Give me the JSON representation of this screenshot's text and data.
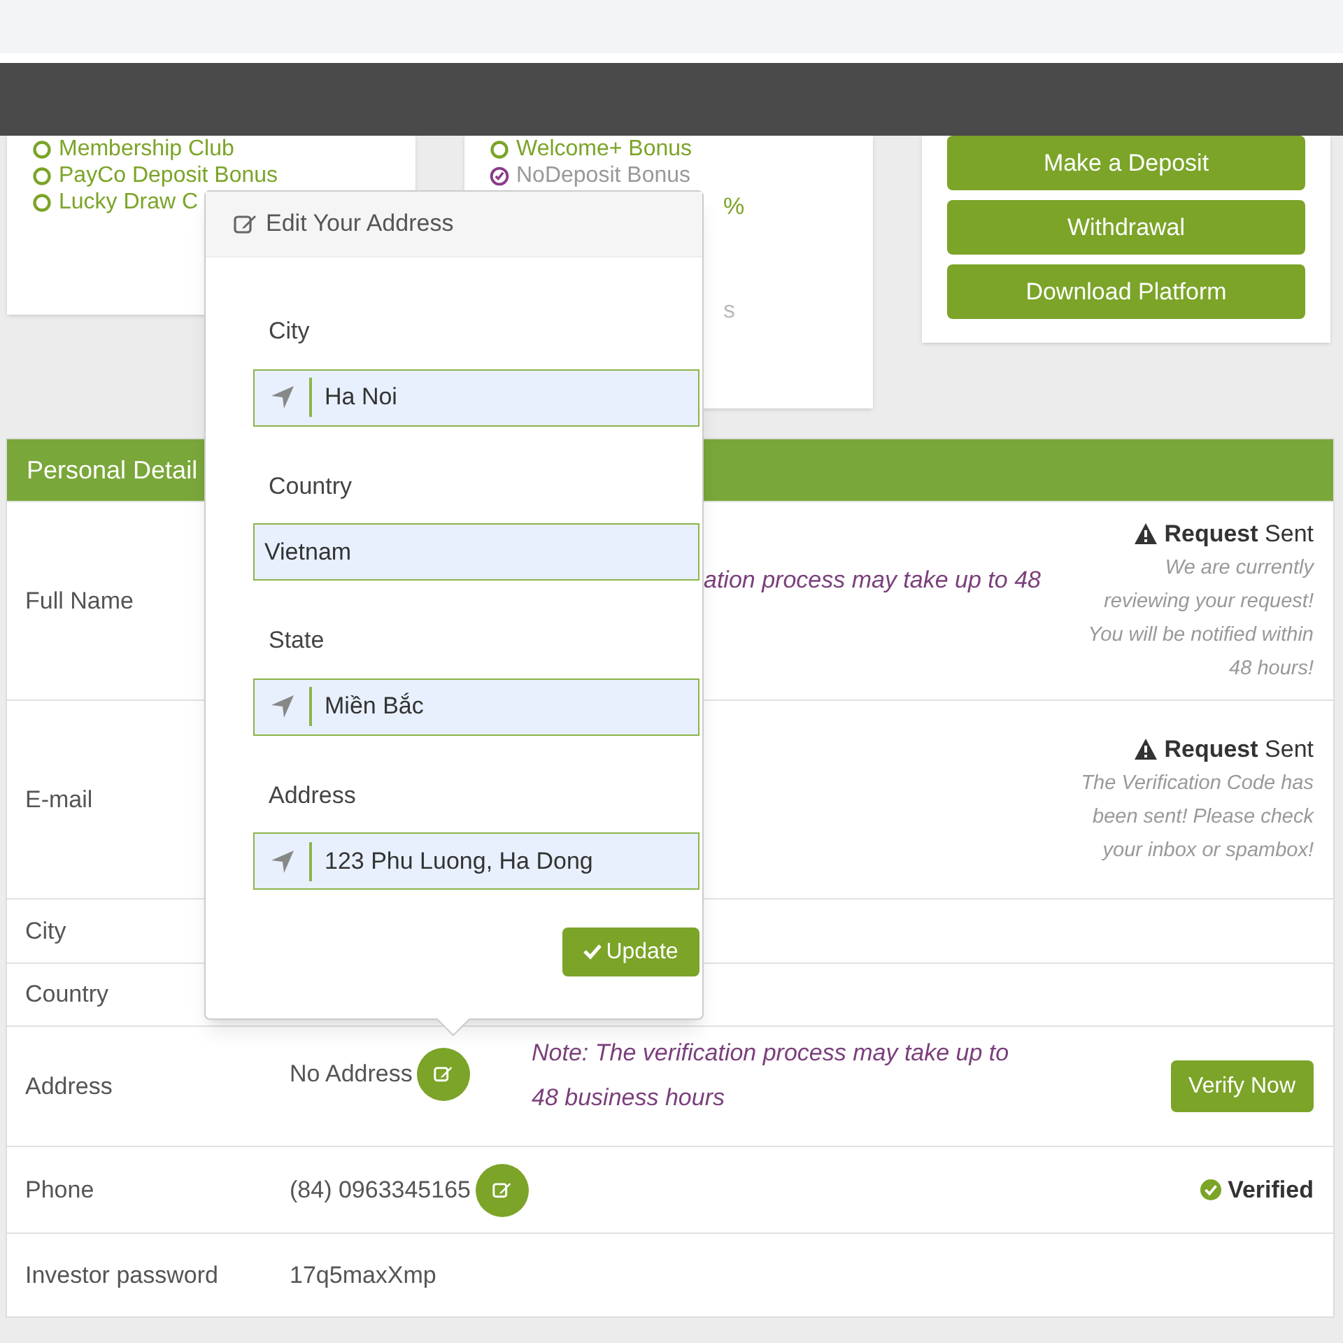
{
  "bonus_cards": [
    {
      "items": [
        {
          "label": "Membership Club",
          "kind": "open"
        },
        {
          "label": "PayCo Deposit Bonus",
          "kind": "open"
        },
        {
          "label": "Lucky Draw C",
          "kind": "open"
        }
      ]
    },
    {
      "items": [
        {
          "label": "Welcome+ Bonus",
          "kind": "open"
        },
        {
          "label": "NoDeposit Bonus",
          "kind": "done"
        }
      ],
      "fragments": [
        "%",
        "s"
      ]
    }
  ],
  "actions": [
    "Make a Deposit",
    "Withdrawal",
    "Download Platform"
  ],
  "personal_details": {
    "title": "Personal Detail",
    "rows": [
      {
        "label": "Full Name",
        "note": "ation process may take up to 48",
        "status": {
          "kind": "request",
          "bold": "Request",
          "rest": "Sent",
          "message": "We are currently reviewing your request! You will be notified within 48 hours!"
        }
      },
      {
        "label": "E-mail",
        "status": {
          "kind": "request",
          "bold": "Request",
          "rest": "Sent",
          "message": "The Verification Code has been sent! Please check your inbox or spambox!"
        }
      },
      {
        "label": "City"
      },
      {
        "label": "Country"
      },
      {
        "label": "Address",
        "value": "No Address",
        "editable": true,
        "note": "Note: The verification process may take up to 48 business hours",
        "button": "Verify Now"
      },
      {
        "label": "Phone",
        "value": "(84) 0963345165",
        "editable": true,
        "status": {
          "kind": "verified",
          "bold": "Verified"
        }
      },
      {
        "label": "Investor password",
        "value": "17q5maxXmp"
      }
    ]
  },
  "popup": {
    "title": "Edit Your Address",
    "fields": [
      {
        "label": "City",
        "value": "Ha Noi",
        "icon": true
      },
      {
        "label": "Country",
        "value": "Vietnam",
        "icon": false
      },
      {
        "label": "State",
        "value": "Miền Bắc",
        "icon": true
      },
      {
        "label": "Address",
        "value": "123 Phu Luong, Ha Dong",
        "icon": true
      }
    ],
    "button": "Update"
  }
}
